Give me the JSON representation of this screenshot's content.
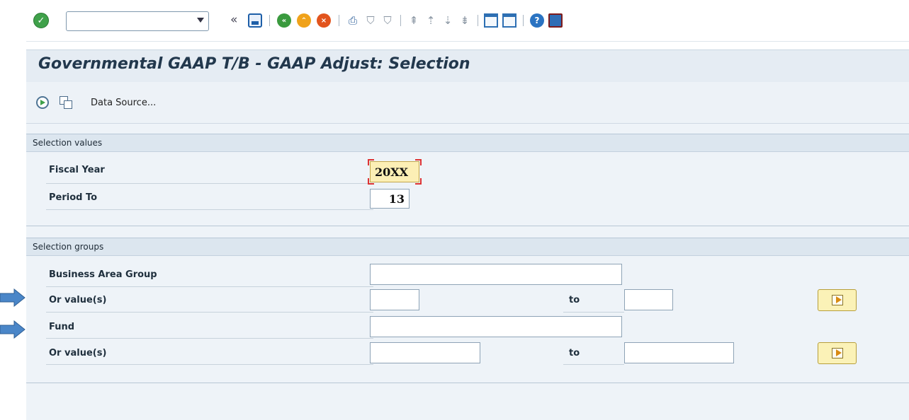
{
  "toolbar": {
    "command_field": {
      "value": "",
      "placeholder": ""
    },
    "icons": [
      "enter-icon",
      "command-dropdown-icon",
      "collapse-icon",
      "save-icon",
      "back-icon",
      "exit-icon",
      "cancel-icon",
      "print-icon",
      "find-icon",
      "find-next-icon",
      "first-page-icon",
      "previous-page-icon",
      "next-page-icon",
      "last-page-icon",
      "new-session-icon",
      "shortcut-icon",
      "help-icon",
      "customize-layout-icon"
    ]
  },
  "title": "Governmental GAAP T/B - GAAP Adjust: Selection",
  "application_toolbar": {
    "data_source_label": "Data Source..."
  },
  "selection_values": {
    "header": "Selection values",
    "fiscal_year": {
      "label": "Fiscal Year",
      "value": "20XX"
    },
    "period_to": {
      "label": "Period To",
      "value": "13"
    }
  },
  "selection_groups": {
    "header": "Selection groups",
    "business_area_group": {
      "label": "Business Area Group",
      "value": ""
    },
    "business_area_values": {
      "label": "Or value(s)",
      "from": "",
      "to_label": "to",
      "to": ""
    },
    "fund": {
      "label": "Fund",
      "value": ""
    },
    "fund_values": {
      "label": "Or value(s)",
      "from": "",
      "to_label": "to",
      "to": ""
    }
  },
  "annotations": {
    "arrow_color": "#4a86c8"
  }
}
